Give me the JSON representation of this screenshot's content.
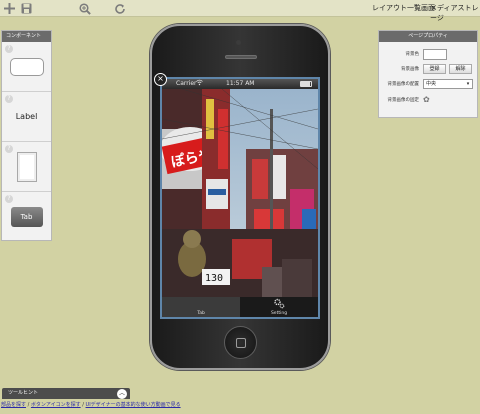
{
  "toolbar": {
    "icons": [
      "plus-icon",
      "save-icon",
      "zoom-icon",
      "refresh-icon"
    ],
    "links": [
      "レイアウト一覧画面",
      "メディアストレージ"
    ]
  },
  "components": {
    "title": "コンポーネント",
    "items": [
      {
        "type": "textfield",
        "help": "?"
      },
      {
        "type": "label",
        "label": "Label",
        "help": "?"
      },
      {
        "type": "view",
        "help": "?"
      },
      {
        "type": "tab",
        "label": "Tab",
        "help": "?"
      }
    ]
  },
  "phone": {
    "status": {
      "carrier": "Carrier",
      "time": "11:57 AM"
    },
    "tabs": [
      {
        "label": "Tab",
        "icon": "tab-icon"
      },
      {
        "label": "Setting",
        "icon": "gear-icon"
      }
    ]
  },
  "properties": {
    "title": "ページプロパティ",
    "bg_color_label": "背景色",
    "bg_image_label": "背景画像",
    "register_button": "登録",
    "delete_button": "解除",
    "bg_align_label": "背景画像の配置",
    "bg_align_value": "中央",
    "bg_fixed_label": "背景画像の固定",
    "bg_fixed_icon": "gear-icon"
  },
  "hint": {
    "title": "ツールヒント",
    "links": [
      "部品を探す",
      "ボタンアイコンを探す",
      "UIデザイナーの基本的な使い方動画で見る"
    ],
    "separator": " / "
  },
  "colors": {
    "background": "#d2d2a3",
    "screen_border": "#5f86aa"
  }
}
